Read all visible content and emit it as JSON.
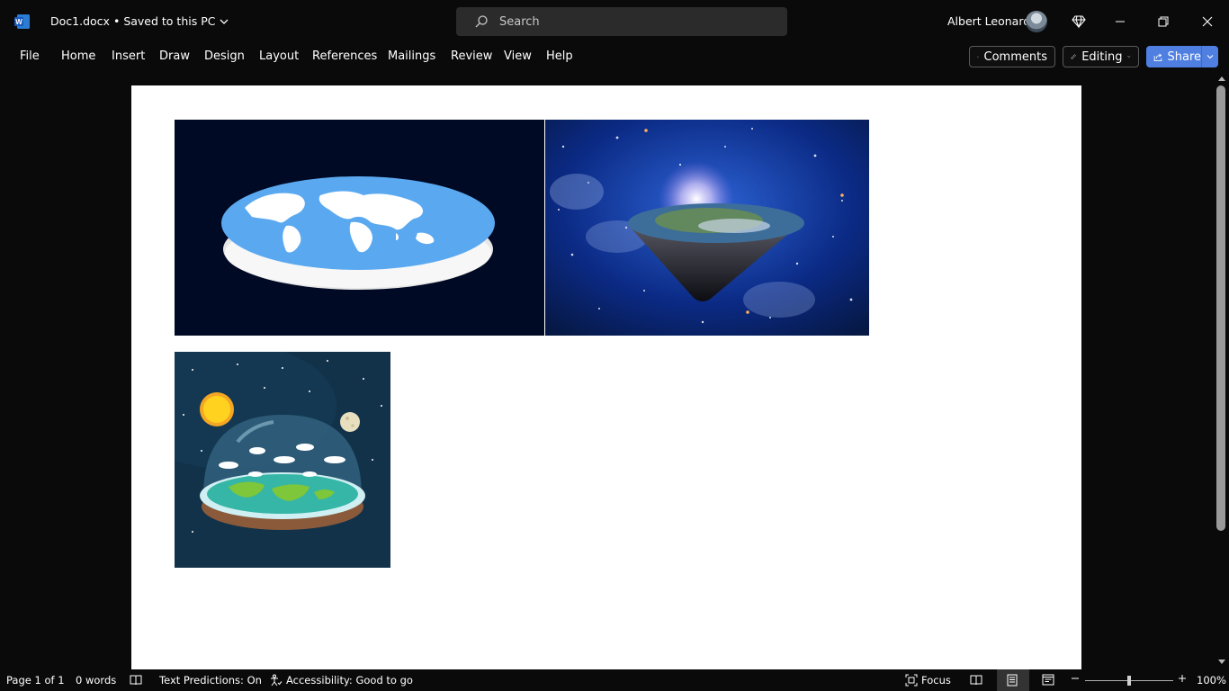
{
  "app": {
    "doc_title": "Doc1.docx",
    "save_status": "Saved to this PC",
    "search_placeholder": "Search",
    "user_name": "Albert Leonard"
  },
  "ribbon": {
    "tabs": [
      "File",
      "Home",
      "Insert",
      "Draw",
      "Design",
      "Layout",
      "References",
      "Mailings",
      "Review",
      "View",
      "Help"
    ],
    "comments_label": "Comments",
    "editing_label": "Editing",
    "share_label": "Share"
  },
  "status": {
    "page": "Page 1 of 1",
    "words": "0 words",
    "text_predictions": "Text Predictions: On",
    "accessibility": "Accessibility: Good to go",
    "focus": "Focus",
    "zoom": "100%"
  },
  "colors": {
    "accent": "#4f7fe0",
    "background": "#0a0a0a",
    "page": "#ffffff"
  },
  "document": {
    "images": [
      "flat-earth-disc-image",
      "flat-earth-cone-space-image",
      "flat-earth-dome-illustration"
    ],
    "text": ""
  }
}
